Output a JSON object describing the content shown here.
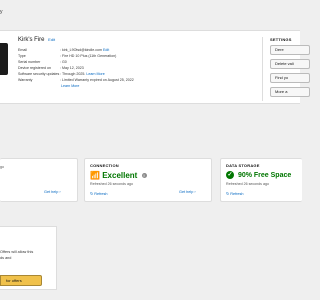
{
  "breadcrumb": "y",
  "device": {
    "name": "Kirk's Fire",
    "edit_label": "Edit",
    "specs": [
      {
        "key": "Email",
        "value": "kirk_L9Otsd@kindle.com",
        "link": "Edit"
      },
      {
        "key": "Type",
        "value": "Fire HD 10 Plus (11th Generation)",
        "link": ""
      },
      {
        "key": "Serial number",
        "value": "G0",
        "link": ""
      },
      {
        "key": "Device registered on",
        "value": "May 12, 2023",
        "link": ""
      },
      {
        "key": "Software security updates",
        "value": "Through 2025.",
        "link": "Learn More"
      },
      {
        "key": "Warranty",
        "value": "Limited Warranty expired on August 25, 2022",
        "link": ""
      },
      {
        "key": "",
        "value": "",
        "link": "Learn More"
      }
    ]
  },
  "settings": {
    "title": "SETTINGS",
    "buttons": [
      "Dere",
      "Delete vali",
      "Find yo",
      "More a"
    ]
  },
  "cards": {
    "first": {
      "subtitle": "go",
      "link": "Get help"
    },
    "connection": {
      "title": "CONNECTION",
      "status": "Excellent",
      "subtitle": "Refreshed 26 seconds ago",
      "refresh": "Refresh",
      "help": "Get help"
    },
    "storage": {
      "title": "DATA STORAGE",
      "status": "90% Free Space",
      "subtitle": "Refreshed 26 seconds ago",
      "refresh": "Refresh"
    }
  },
  "offers": {
    "lines": [
      "Offers will allow this",
      "ds and"
    ],
    "button": "for offers"
  },
  "colors": {
    "link": "#0066c0",
    "good": "#007600",
    "offers_button": "#f0c14b"
  }
}
